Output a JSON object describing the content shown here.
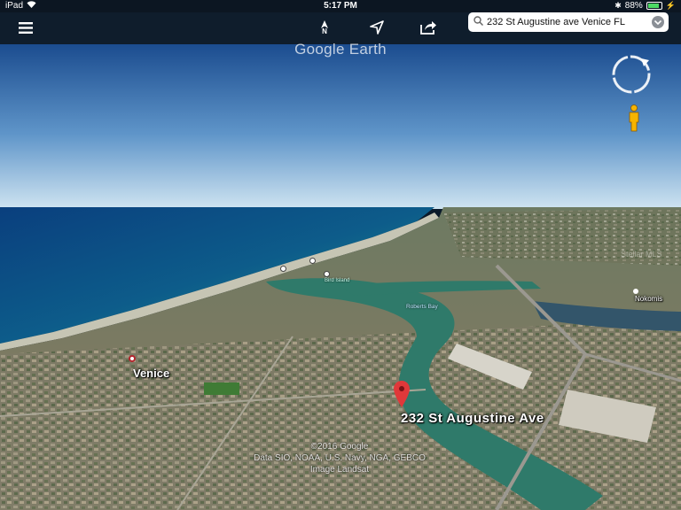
{
  "status_bar": {
    "device": "iPad",
    "time": "5:17 PM",
    "battery_percent": "88%",
    "battery_level": 0.88
  },
  "toolbar": {
    "north_label": "N",
    "search_value": "232 St Augustine ave Venice FL",
    "icons": [
      "menu-icon",
      "north-arrow-icon",
      "my-location-icon",
      "share-icon",
      "search-icon",
      "dropdown-icon"
    ]
  },
  "map": {
    "watermark": "Google Earth",
    "place_label": "Venice",
    "pin_label": "232 St Augustine Ave",
    "nokomis_label": "Nokomis",
    "water_label": "Roberts Bay",
    "island_label": "Bird Island",
    "faint_label": "Stellar MLS",
    "copyright_lines": [
      "©2016 Google",
      "Data SIO, NOAA, U.S. Navy, NGA, GEBCO",
      "Image Landsat"
    ]
  },
  "colors": {
    "sky_top": "#1a4e92",
    "sky_horizon": "#cde3f0",
    "ocean": "#0d4a8a",
    "shallow": "#1f9e8e",
    "land": "#7a7a5a",
    "pin": "#e0383a"
  }
}
